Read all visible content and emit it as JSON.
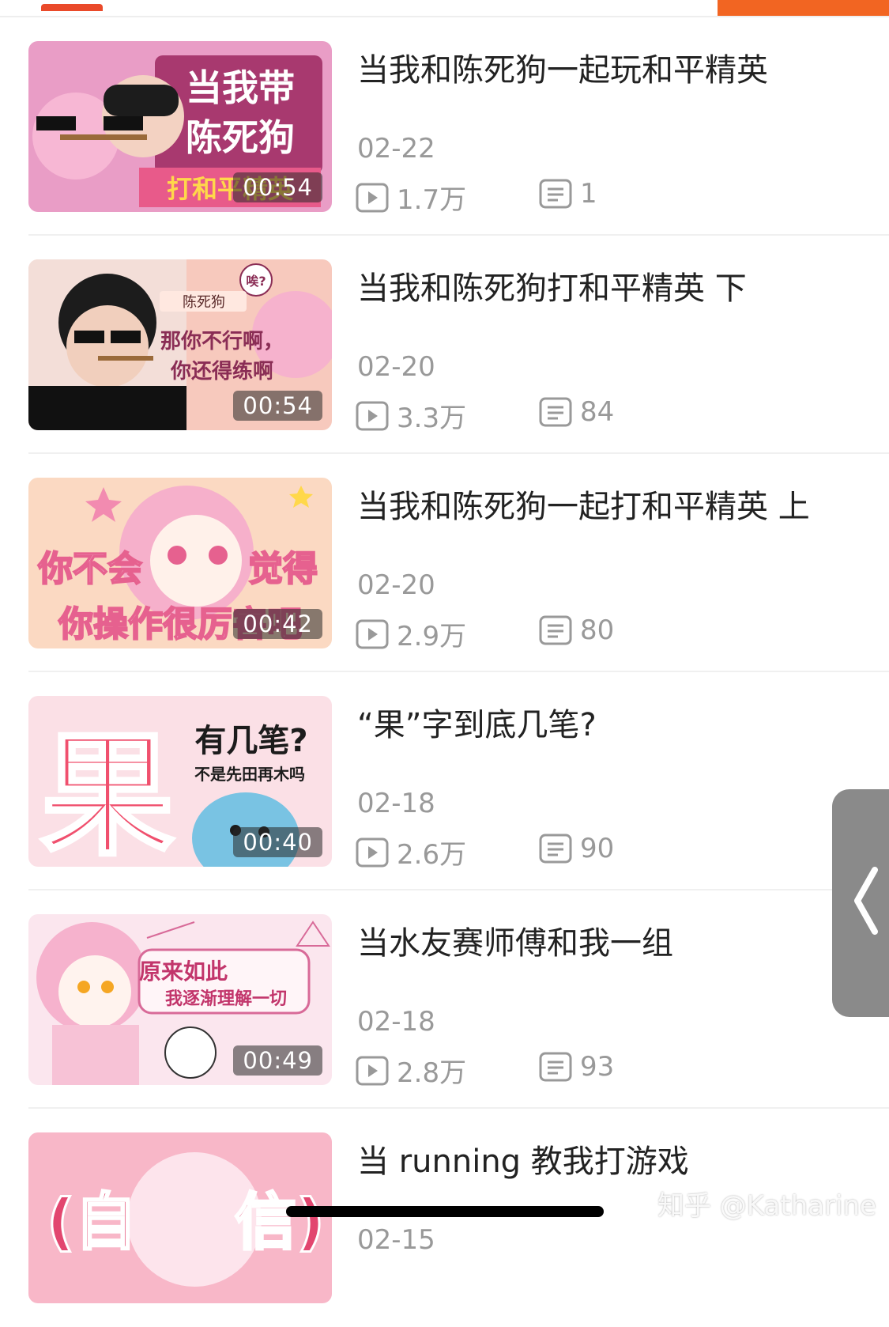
{
  "videos": [
    {
      "title": "当我和陈死狗一起玩和平精英",
      "date": "02-22",
      "duration": "00:54",
      "views": "1.7万",
      "comments": "1",
      "thumb_text": [
        "当我带",
        "陈死狗",
        "打和平精英"
      ]
    },
    {
      "title": "当我和陈死狗打和平精英 下",
      "date": "02-20",
      "duration": "00:54",
      "views": "3.3万",
      "comments": "84",
      "thumb_text": [
        "陈死狗",
        "那你不行啊，",
        "你还得练啊",
        "唉?"
      ]
    },
    {
      "title": "当我和陈死狗一起打和平精英 上",
      "date": "02-20",
      "duration": "00:42",
      "views": "2.9万",
      "comments": "80",
      "thumb_text": [
        "你不会",
        "觉得",
        "你操作很厉害吧"
      ]
    },
    {
      "title": "“果”字到底几笔?",
      "date": "02-18",
      "duration": "00:40",
      "views": "2.6万",
      "comments": "90",
      "thumb_text": [
        "果",
        "有几笔?",
        "不是先田再木吗"
      ]
    },
    {
      "title": "当水友赛师傅和我一组",
      "date": "02-18",
      "duration": "00:49",
      "views": "2.8万",
      "comments": "93",
      "thumb_text": [
        "原来如此",
        "我逐渐理解一切"
      ]
    },
    {
      "title": "当 running 教我打游戏",
      "date": "02-15",
      "duration": "",
      "views": "",
      "comments": "",
      "thumb_text": [
        "(自",
        "信)"
      ]
    }
  ],
  "watermark": "知乎 @Katharine",
  "icons": {
    "play": "play-count-icon",
    "comment": "comment-count-icon",
    "side": "chevron-left-icon"
  },
  "colors": {
    "accent": "#f26522",
    "indicator": "#ea4a2a",
    "meta": "#999999",
    "pink": "#f4a6c4"
  }
}
